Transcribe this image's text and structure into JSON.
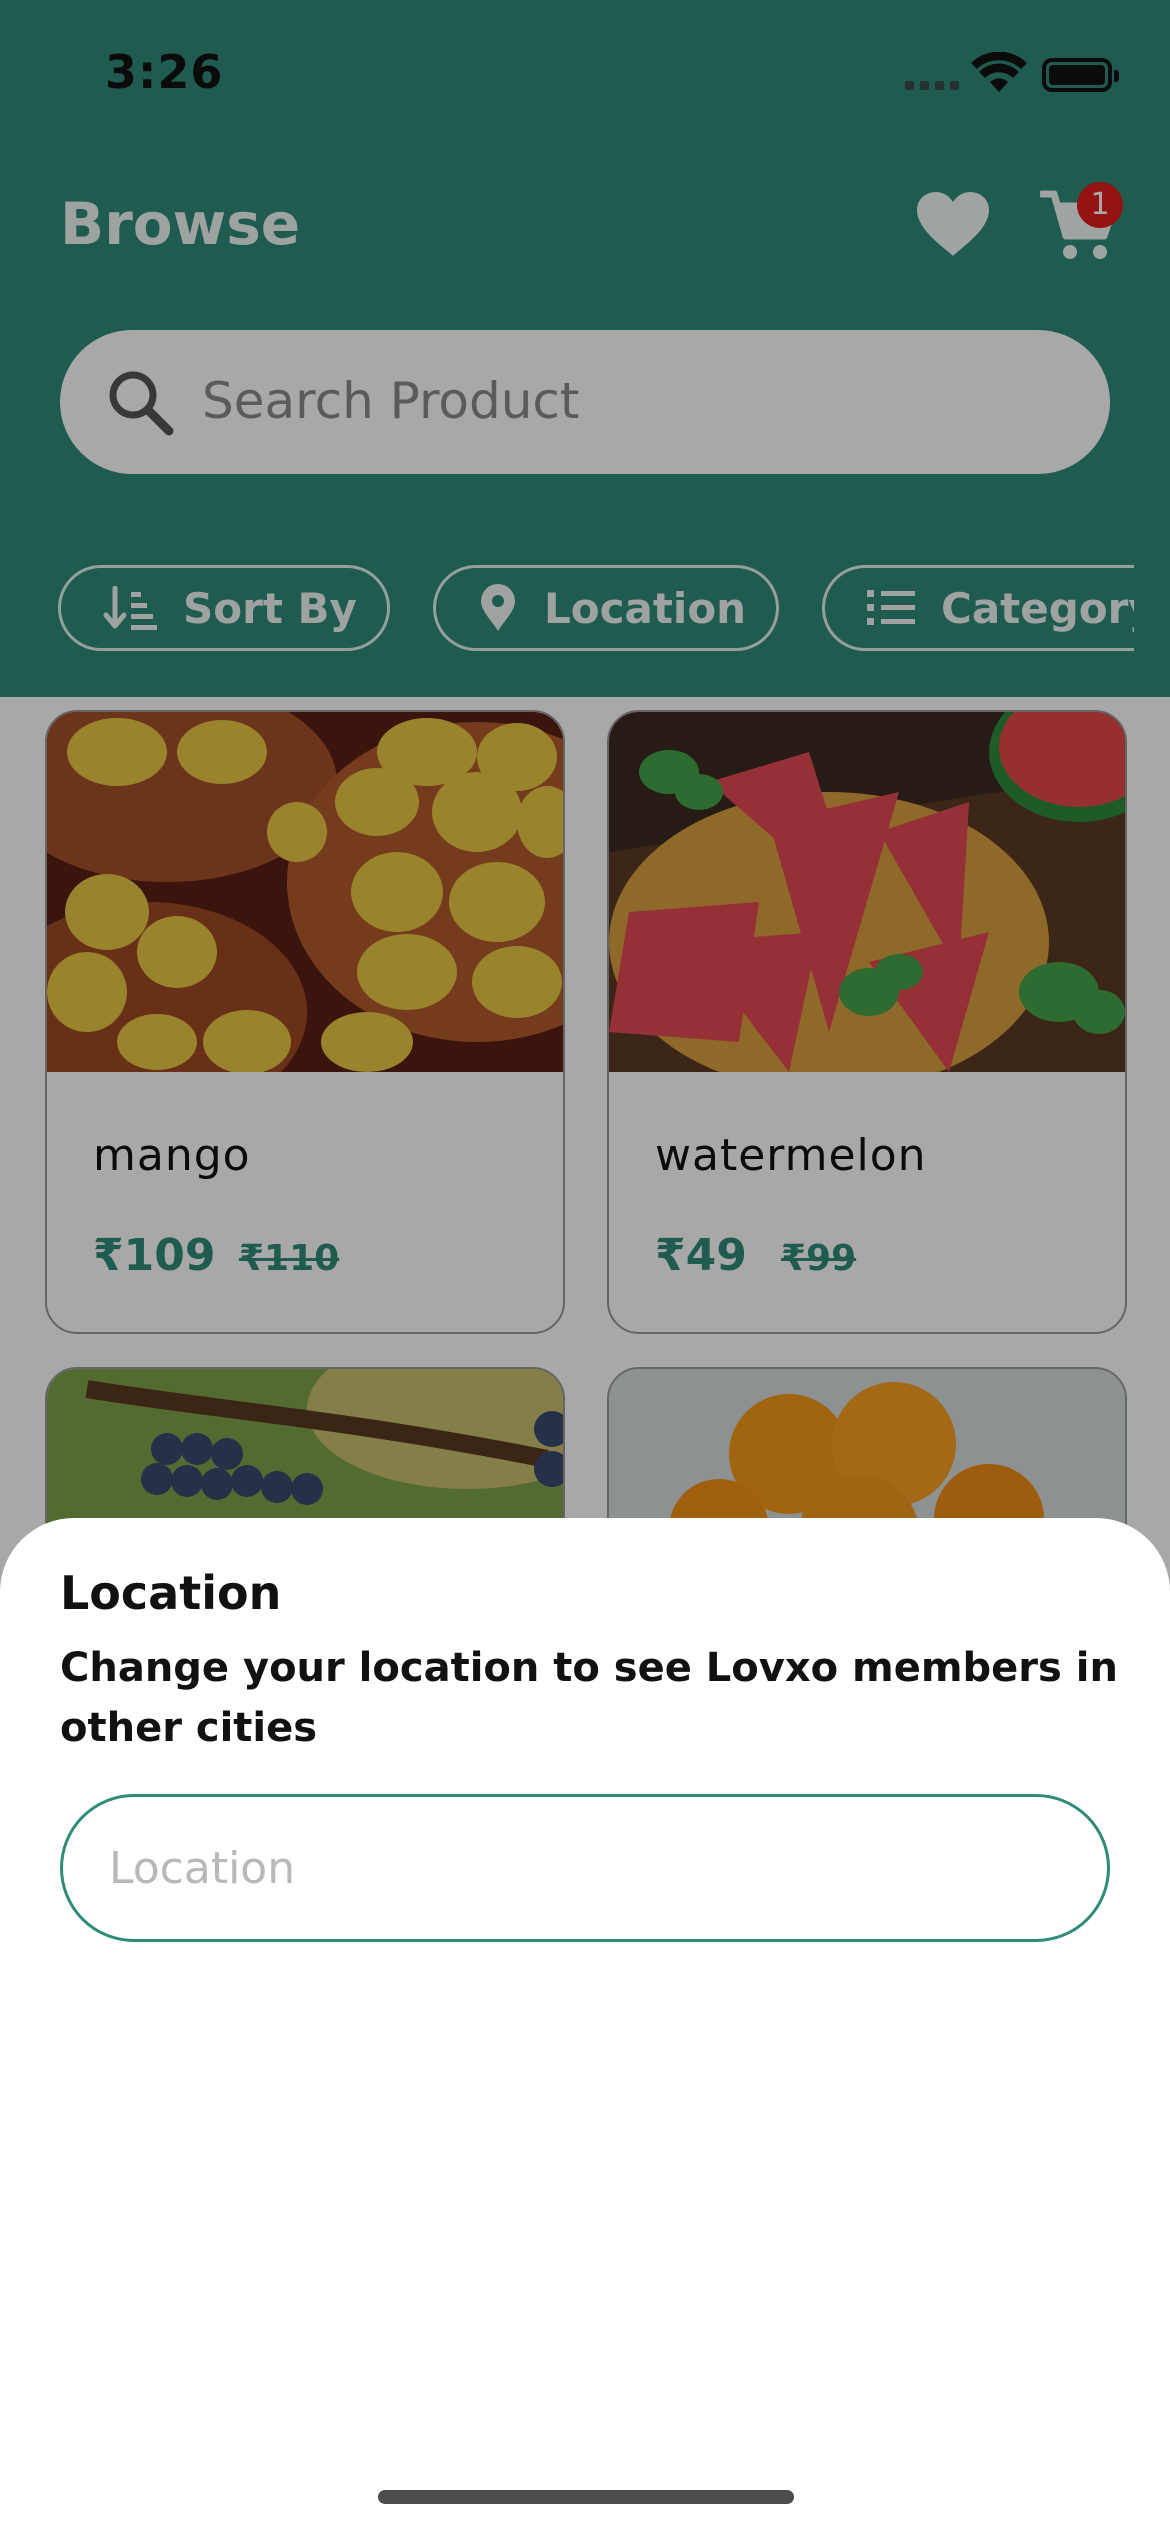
{
  "status_bar": {
    "time": "3:26"
  },
  "header": {
    "title": "Browse",
    "cart_badge": "1"
  },
  "search": {
    "placeholder": "Search Product"
  },
  "filters": [
    {
      "label": "Sort By",
      "icon": "sort-icon"
    },
    {
      "label": "Location",
      "icon": "location-pin-icon"
    },
    {
      "label": "Category",
      "icon": "list-icon"
    }
  ],
  "products": [
    {
      "name": "mango",
      "price": "₹109",
      "old_price": "₹110"
    },
    {
      "name": "watermelon",
      "price": "₹49",
      "old_price": "₹99"
    },
    {
      "name": "",
      "price": "",
      "old_price": ""
    },
    {
      "name": "",
      "price": "",
      "old_price": ""
    }
  ],
  "location_sheet": {
    "title": "Location",
    "subtitle": "Change your location to see Lovxo members in other cities",
    "input_placeholder": "Location"
  },
  "colors": {
    "brand": "#2f8c78",
    "badge": "#e21d1d",
    "overlay": "rgba(0,0,0,0.34)"
  }
}
